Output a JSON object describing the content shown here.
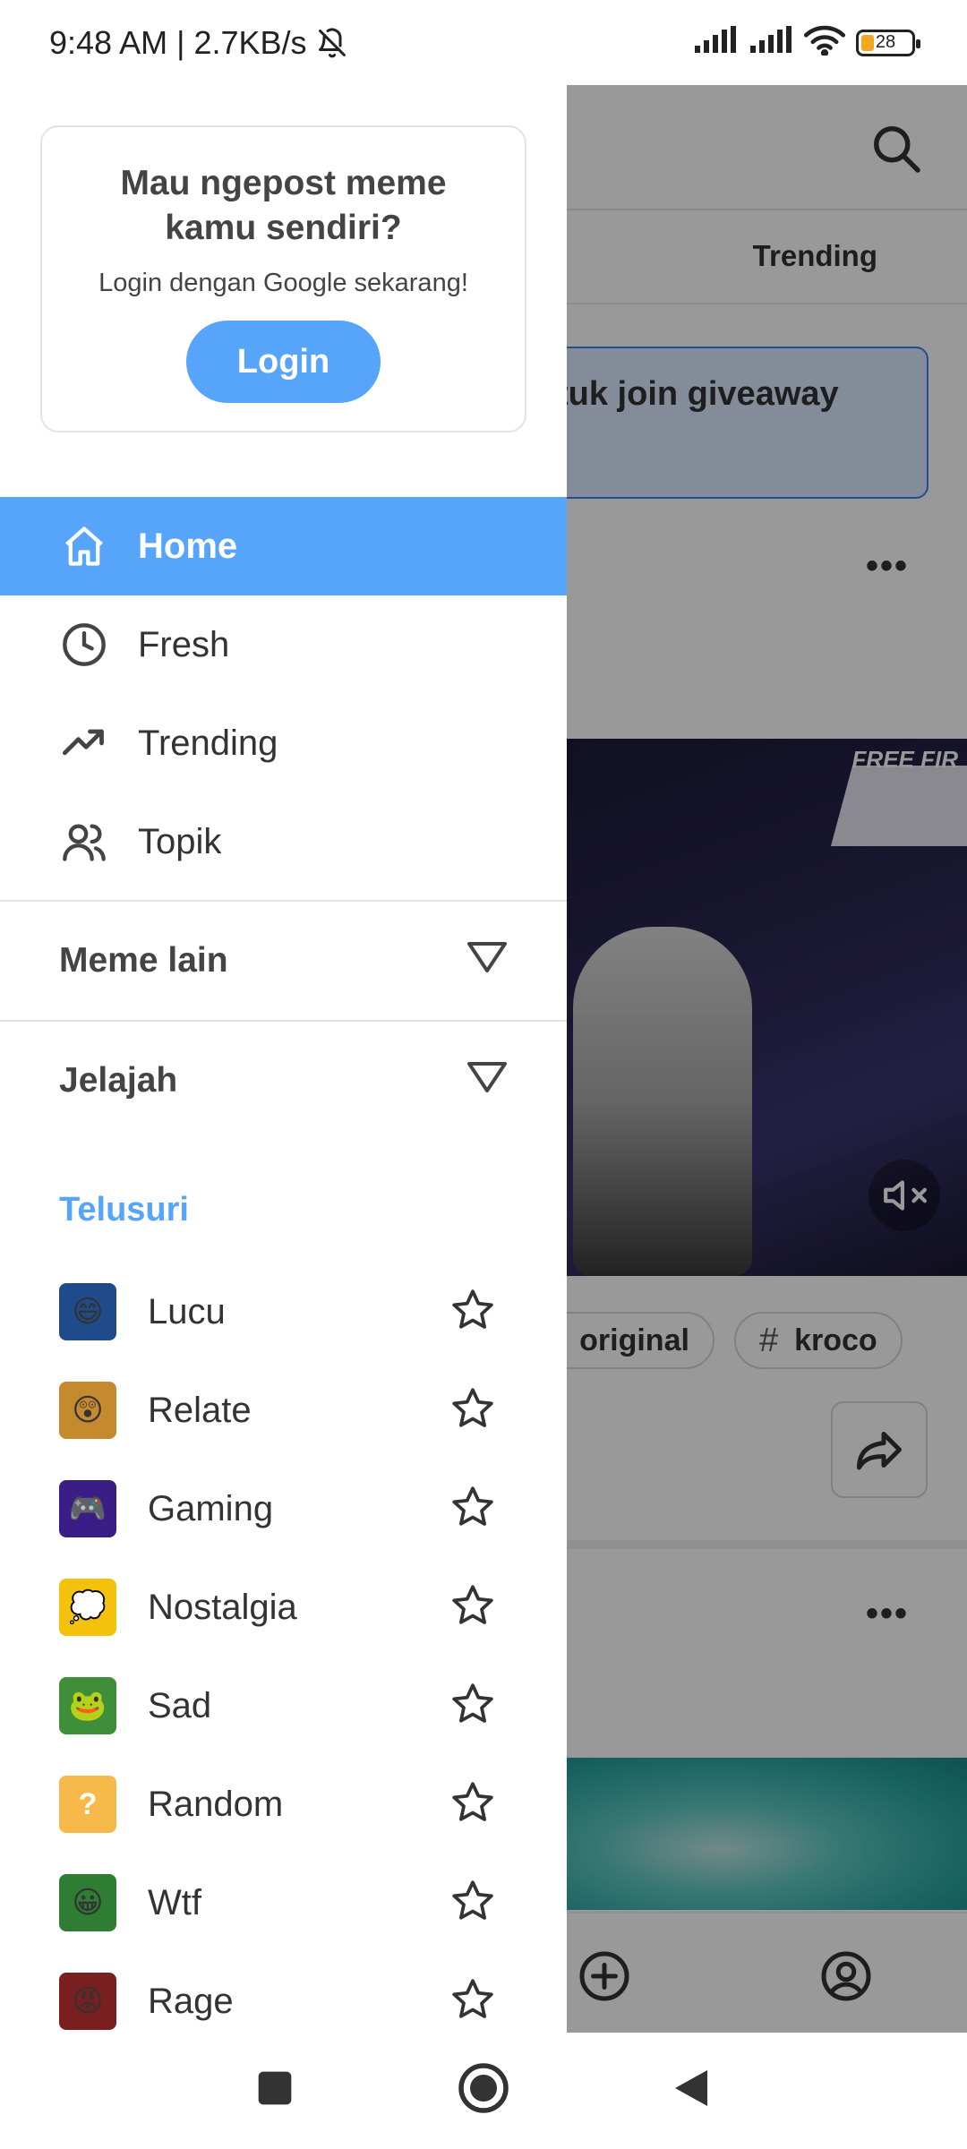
{
  "status_bar": {
    "time_speed": "9:48 AM | 2.7KB/s",
    "battery": "28",
    "icons": [
      "bell-off-icon",
      "signal-icon",
      "signal-icon",
      "wifi-icon",
      "battery-icon"
    ]
  },
  "background": {
    "tab_trending": "Trending",
    "banner_text": "tuk join giveaway",
    "video_brand": "FREE FIR",
    "chips": [
      "original",
      "kroco"
    ]
  },
  "drawer": {
    "login_card": {
      "title": "Mau ngepost meme kamu sendiri?",
      "subtitle": "Login dengan Google sekarang!",
      "button": "Login"
    },
    "menu": [
      {
        "label": "Home",
        "icon": "home-icon",
        "active": true
      },
      {
        "label": "Fresh",
        "icon": "clock-icon",
        "active": false
      },
      {
        "label": "Trending",
        "icon": "trending-up-icon",
        "active": false
      },
      {
        "label": "Topik",
        "icon": "users-icon",
        "active": false
      }
    ],
    "sections": {
      "meme_lain": "Meme lain",
      "jelajah": "Jelajah"
    },
    "explore_title": "Telusuri",
    "categories": [
      {
        "label": "Lucu",
        "icon": "lucu-thumb"
      },
      {
        "label": "Relate",
        "icon": "relate-thumb"
      },
      {
        "label": "Gaming",
        "icon": "gaming-thumb"
      },
      {
        "label": "Nostalgia",
        "icon": "nostalgia-thumb"
      },
      {
        "label": "Sad",
        "icon": "sad-thumb"
      },
      {
        "label": "Random",
        "icon": "random-thumb"
      },
      {
        "label": "Wtf",
        "icon": "wtf-thumb"
      },
      {
        "label": "Rage",
        "icon": "rage-thumb"
      }
    ]
  },
  "colors": {
    "accent": "#57a4fb",
    "text": "#333333",
    "scrim": "rgba(0,0,0,0.4)"
  }
}
